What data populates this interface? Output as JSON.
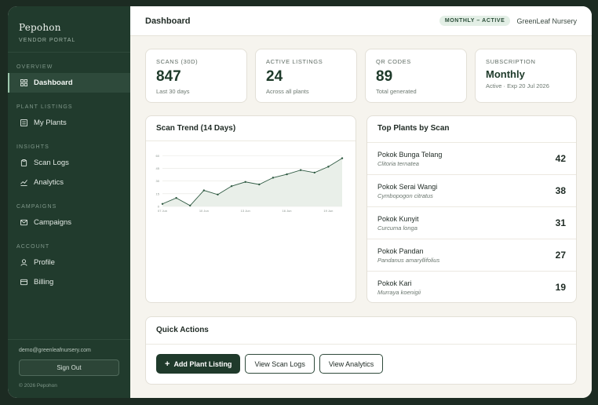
{
  "sidebar": {
    "brand": "Pepohon",
    "brand_sub": "Vendor Portal",
    "groups": [
      {
        "heading": "Overview",
        "items": [
          {
            "label": "Dashboard",
            "icon": "grid-icon",
            "active": true
          }
        ]
      },
      {
        "heading": "Plant Listings",
        "items": [
          {
            "label": "My Plants",
            "icon": "list-icon"
          }
        ]
      },
      {
        "heading": "Insights",
        "items": [
          {
            "label": "Scan Logs",
            "icon": "clipboard-icon"
          },
          {
            "label": "Analytics",
            "icon": "bar-chart-icon"
          }
        ]
      },
      {
        "heading": "Campaigns",
        "items": [
          {
            "label": "Campaigns",
            "icon": "mail-icon"
          }
        ]
      },
      {
        "heading": "Account",
        "items": [
          {
            "label": "Profile",
            "icon": "user-icon"
          },
          {
            "label": "Billing",
            "icon": "card-icon"
          }
        ]
      }
    ],
    "email": "demo@greenleafnursery.com",
    "sign_out": "Sign Out",
    "copyright": "© 2026 Pepohon"
  },
  "header": {
    "title": "Dashboard",
    "badge": "MONTHLY – ACTIVE",
    "org": "GreenLeaf Nursery"
  },
  "stats": [
    {
      "label": "Scans (30d)",
      "value": "847",
      "sub": "Last 30 days"
    },
    {
      "label": "Active Listings",
      "value": "24",
      "sub": "Across all plants"
    },
    {
      "label": "QR Codes",
      "value": "89",
      "sub": "Total generated"
    },
    {
      "label": "Subscription",
      "value": "Monthly",
      "sub": "Active · Exp 20 Jul 2026"
    }
  ],
  "trend": {
    "title": "Scan Trend (14 Days)",
    "chart_data": {
      "type": "area",
      "x": [
        "07 Jun",
        "08 Jun",
        "09 Jun",
        "10 Jun",
        "11 Jun",
        "12 Jun",
        "13 Jun",
        "14 Jun",
        "15 Jun",
        "16 Jun",
        "17 Jun",
        "18 Jun",
        "19 Jun",
        "20 Jun"
      ],
      "values": [
        3,
        10,
        1,
        19,
        14,
        24,
        29,
        26,
        34,
        38,
        43,
        40,
        47,
        57
      ],
      "ylim": [
        0,
        65
      ],
      "y_ticks": [
        0,
        15,
        30,
        45,
        60
      ],
      "x_tick_labels": [
        "07 Jun",
        "10 Jun",
        "13 Jun",
        "16 Jun",
        "19 Jun"
      ],
      "colors": {
        "line": "#2f5a42",
        "fill": "#e9efe9",
        "grid": "#e6e6e0"
      }
    }
  },
  "top_plants": {
    "title": "Top Plants by Scan",
    "items": [
      {
        "name": "Pokok Bunga Telang",
        "sci": "Clitoria ternatea",
        "count": "42"
      },
      {
        "name": "Pokok Serai Wangi",
        "sci": "Cymbopogon citratus",
        "count": "38"
      },
      {
        "name": "Pokok Kunyit",
        "sci": "Curcuma longa",
        "count": "31"
      },
      {
        "name": "Pokok Pandan",
        "sci": "Pandanus amaryllifolius",
        "count": "27"
      },
      {
        "name": "Pokok Kari",
        "sci": "Murraya koenigii",
        "count": "19"
      }
    ]
  },
  "quick_actions": {
    "title": "Quick Actions",
    "add_plant": "Add Plant Listing",
    "view_scans": "View Scan Logs",
    "view_analytics": "View Analytics"
  }
}
